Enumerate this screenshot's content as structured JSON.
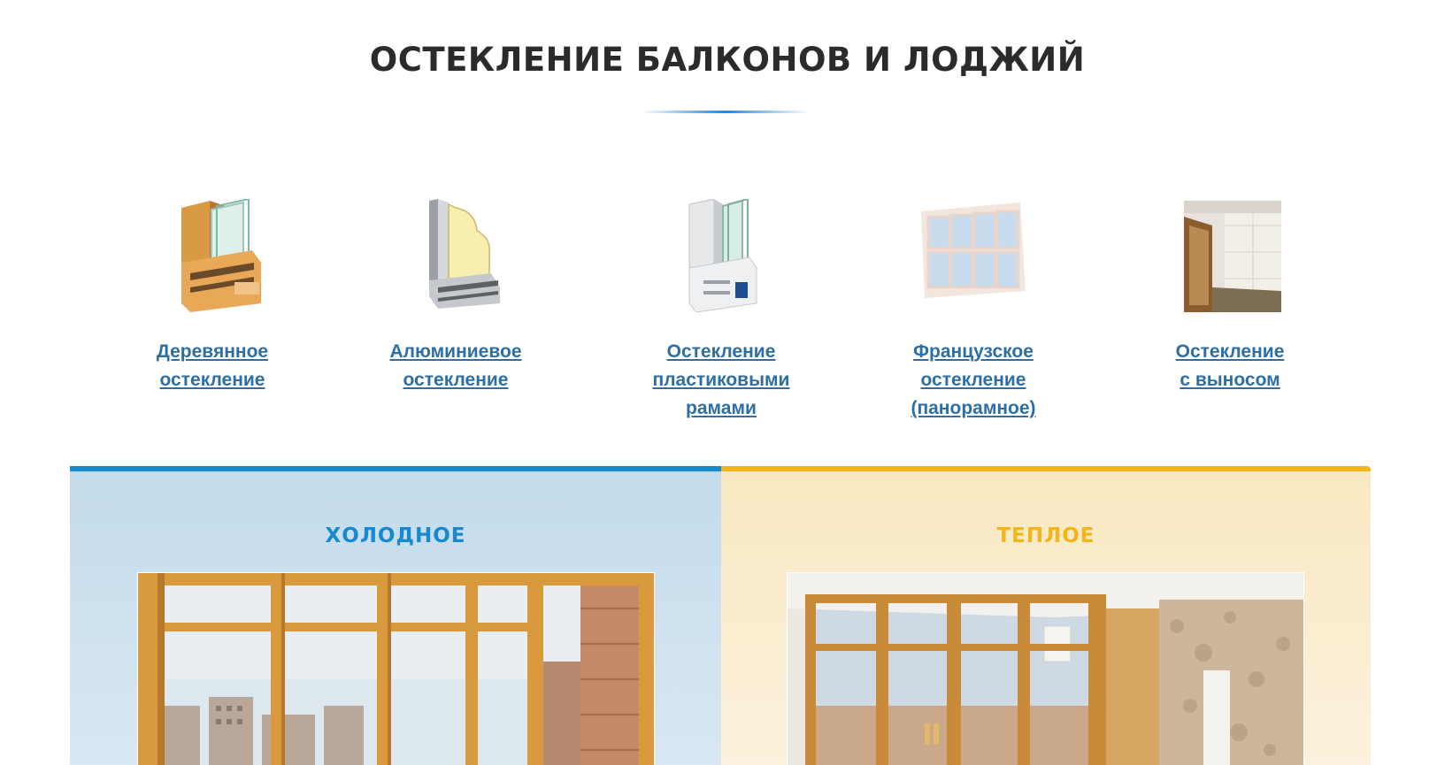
{
  "heading": "ОСТЕКЛЕНИЕ БАЛКОНОВ И ЛОДЖИЙ",
  "types": [
    {
      "line1": "Деревянное",
      "line2": "остекление",
      "line3": ""
    },
    {
      "line1": "Алюминиевое",
      "line2": "остекление",
      "line3": ""
    },
    {
      "line1": "Остекление",
      "line2": "пластиковыми",
      "line3": "рамами"
    },
    {
      "line1": "Французское",
      "line2": "остекление",
      "line3": "(панорамное)"
    },
    {
      "line1": "Остекление",
      "line2": "с выносом",
      "line3": ""
    }
  ],
  "panels": {
    "cold": {
      "title": "ХОЛОДНОЕ",
      "accent": "#1689cf"
    },
    "warm": {
      "title": "ТЕПЛОЕ",
      "accent": "#f4b51a"
    }
  },
  "colors": {
    "link": "#2b6fa6",
    "heading": "#2b2b2b",
    "underline": "#1e88e5"
  }
}
